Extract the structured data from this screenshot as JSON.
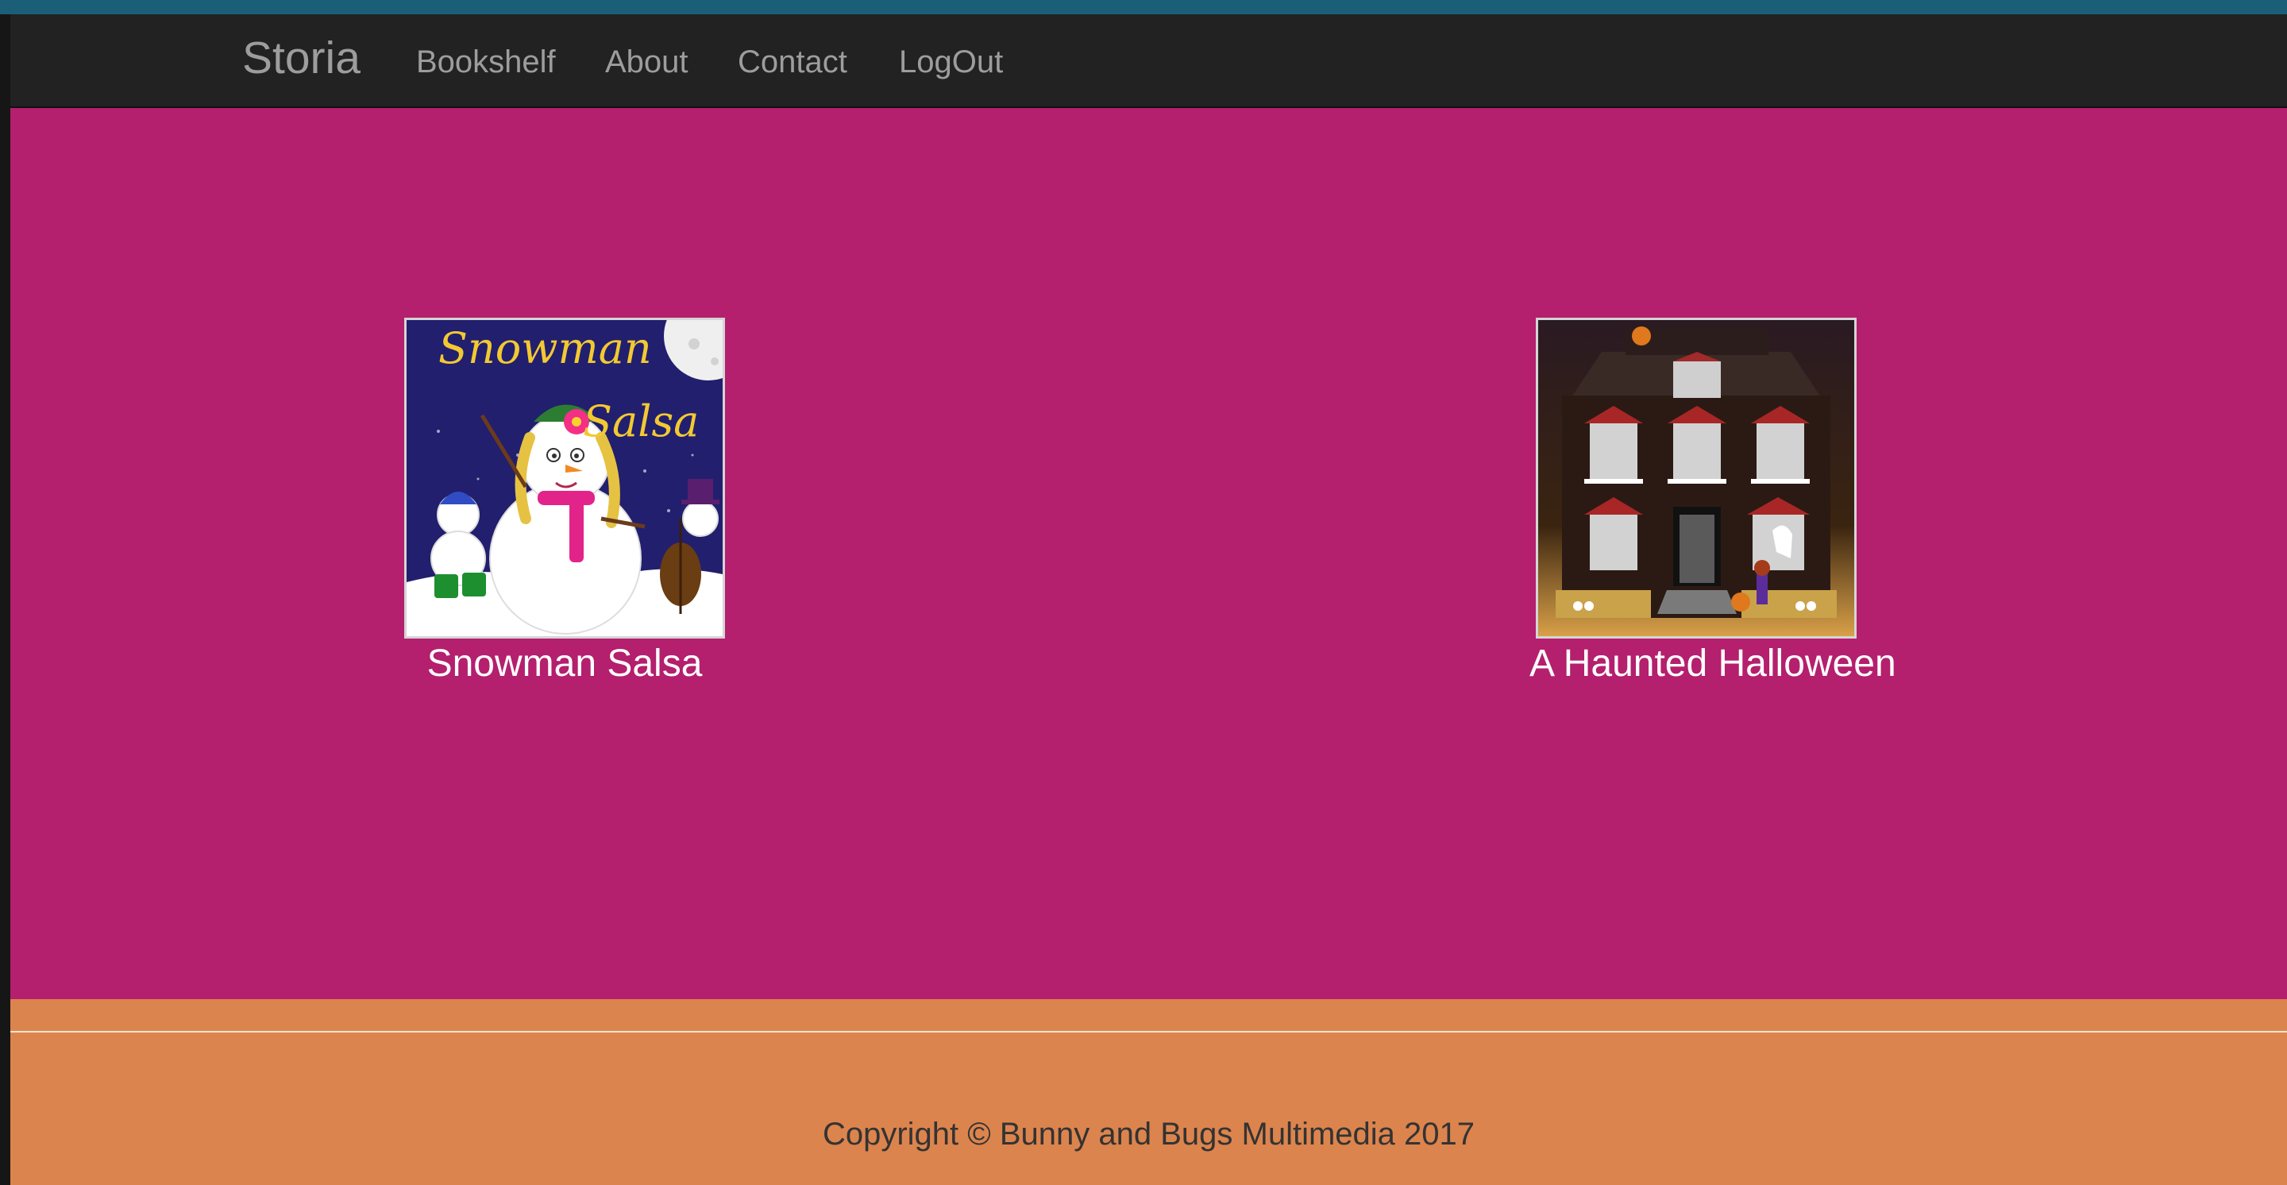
{
  "navbar": {
    "brand": "Storia",
    "links": [
      "Bookshelf",
      "About",
      "Contact",
      "LogOut"
    ]
  },
  "bookshelf": {
    "books": [
      {
        "title": "Snowman Salsa",
        "cover_text": [
          "Snowman",
          "Salsa"
        ]
      },
      {
        "title": "A Haunted Halloween"
      }
    ]
  },
  "footer": {
    "copyright": "Copyright © Bunny and Bugs Multimedia 2017"
  },
  "colors": {
    "navbar_bg": "#222222",
    "nav_text": "#9d9d9d",
    "main_bg": "#b41f6e",
    "footer_bg": "#dc844d",
    "top_strip": "#1a5e78"
  }
}
